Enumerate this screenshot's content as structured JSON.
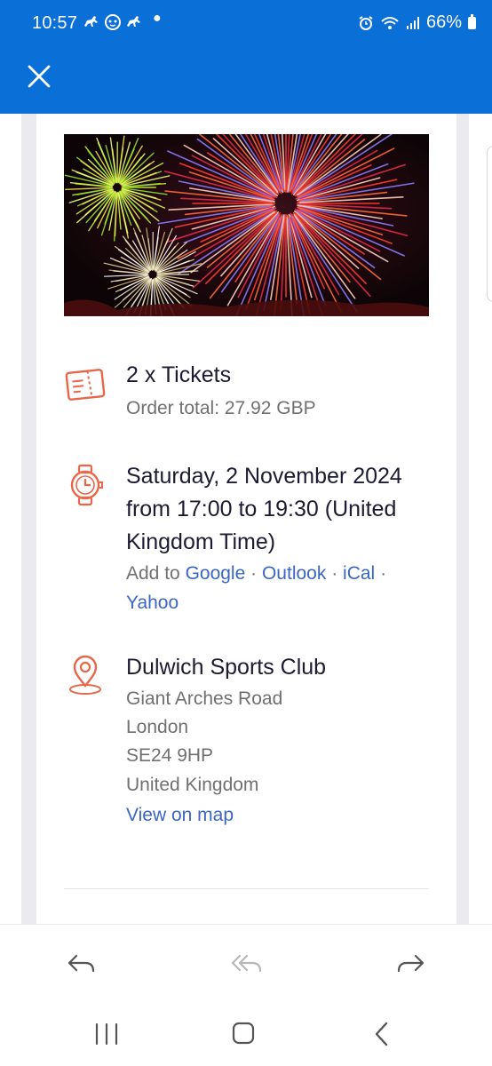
{
  "status_bar": {
    "time": "10:57",
    "notification_icons": [
      "horse-rider-icon",
      "cat-face-icon",
      "horse-rider-icon"
    ],
    "battery": "66%"
  },
  "ticket": {
    "quantity_text": "2 x Tickets",
    "order_total": "Order total: 27.92 GBP"
  },
  "event": {
    "date_line1": "Saturday, 2 November 2024",
    "date_line2": "from 17:00 to 19:30 (United",
    "date_line3": "Kingdom Time)",
    "add_to_label": "Add to",
    "calendars": {
      "google": "Google",
      "outlook": "Outlook",
      "ical": "iCal",
      "yahoo": "Yahoo"
    },
    "separator": "·"
  },
  "venue": {
    "name": "Dulwich Sports Club",
    "address_line1": "Giant Arches Road",
    "address_line2": "London",
    "postcode": "SE24 9HP",
    "country": "United Kingdom",
    "map_link": "View on map"
  },
  "colors": {
    "app_blue": "#0a6fd6",
    "accent_orange": "#e8664a",
    "link_blue": "#3a66c4"
  },
  "action_icons": [
    "reply-icon",
    "reply-all-icon",
    "forward-icon"
  ],
  "nav_icons": [
    "recent-apps-icon",
    "home-icon",
    "back-icon"
  ]
}
